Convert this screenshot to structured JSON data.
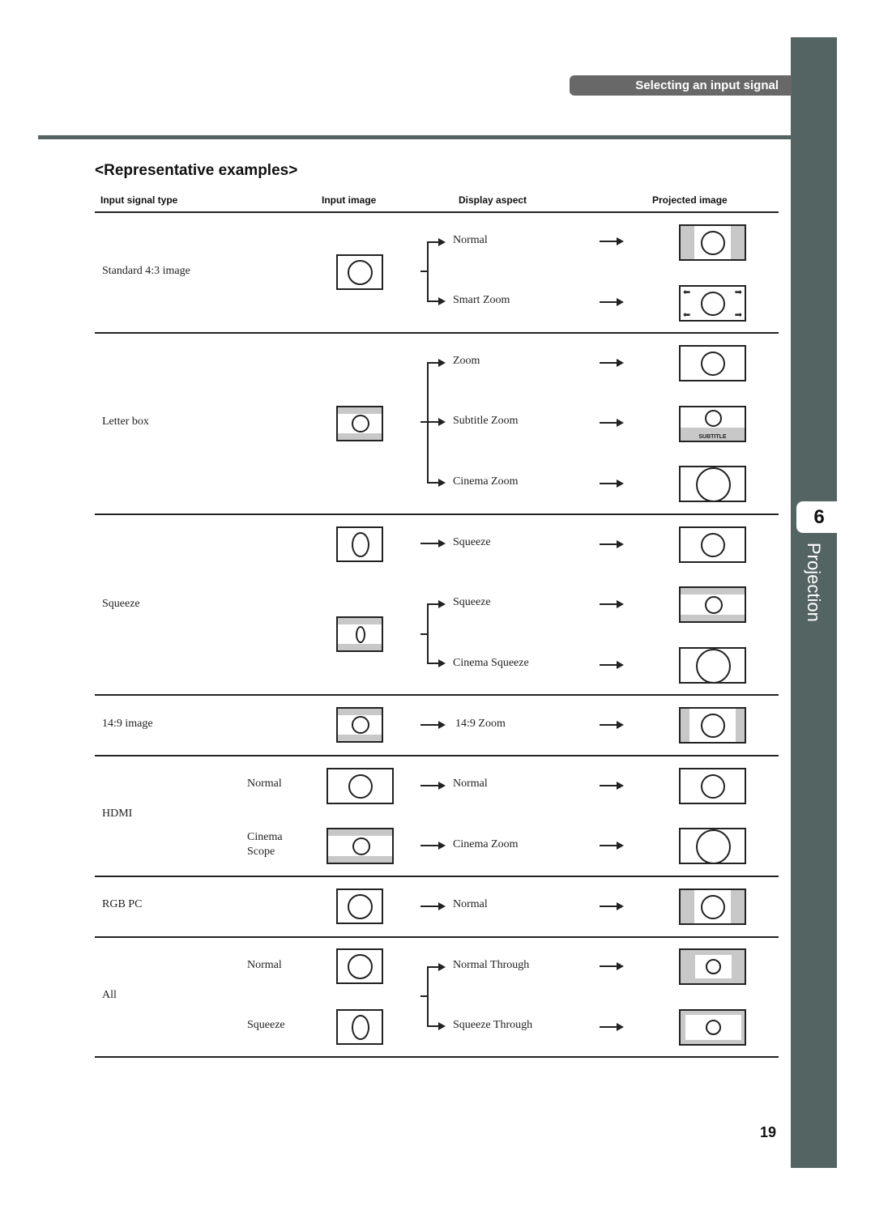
{
  "header": {
    "section_label": "Selecting an input signal",
    "chapter_number": "6",
    "chapter_label": "Projection"
  },
  "title": "<Representative examples>",
  "columns": [
    "Input signal type",
    "Input image",
    "Display aspect",
    "Projected image"
  ],
  "groups": [
    {
      "signal_type": "Standard 4:3 image",
      "rows": [
        {
          "sub_type": "",
          "display_aspect": "Normal",
          "input_image": "4:3 circle",
          "projected_image": "pillarbox circle"
        },
        {
          "sub_type": "",
          "display_aspect": "Smart Zoom",
          "input_image": "4:3 circle",
          "projected_image": "stretched edges circle"
        }
      ]
    },
    {
      "signal_type": "Letter box",
      "rows": [
        {
          "sub_type": "",
          "display_aspect": "Zoom",
          "input_image": "letterbox circle",
          "projected_image": "full circle"
        },
        {
          "sub_type": "",
          "display_aspect": "Subtitle Zoom",
          "input_image": "letterbox circle",
          "projected_image": "circle with subtitle band"
        },
        {
          "sub_type": "",
          "display_aspect": "Cinema Zoom",
          "input_image": "letterbox circle",
          "projected_image": "large circle"
        }
      ],
      "subtitle_label": "SUBTITLE"
    },
    {
      "signal_type": "Squeeze",
      "rows": [
        {
          "sub_type": "",
          "display_aspect": "Squeeze",
          "input_image": "squeezed oval",
          "projected_image": "full circle"
        },
        {
          "sub_type": "",
          "display_aspect": "Squeeze",
          "input_image": "letterbox squeezed oval",
          "projected_image": "letterbox circle"
        },
        {
          "sub_type": "",
          "display_aspect": "Cinema Squeeze",
          "input_image": "letterbox squeezed oval",
          "projected_image": "large circle"
        }
      ]
    },
    {
      "signal_type": "14:9 image",
      "rows": [
        {
          "sub_type": "",
          "display_aspect": "14:9 Zoom",
          "input_image": "14:9 letterbox",
          "projected_image": "pillarbox circle"
        }
      ]
    },
    {
      "signal_type": "HDMI",
      "rows": [
        {
          "sub_type": "Normal",
          "display_aspect": "Normal",
          "input_image": "wide circle",
          "projected_image": "full circle"
        },
        {
          "sub_type_lines": [
            "Cinema",
            "Scope"
          ],
          "display_aspect": "Cinema Zoom",
          "input_image": "scope letterbox",
          "projected_image": "large circle"
        }
      ]
    },
    {
      "signal_type": "RGB PC",
      "rows": [
        {
          "sub_type": "",
          "display_aspect": "Normal",
          "input_image": "4:3 circle",
          "projected_image": "pillarbox circle"
        }
      ]
    },
    {
      "signal_type": "All",
      "rows": [
        {
          "sub_type": "Normal",
          "display_aspect": "Normal Through",
          "input_image": "4:3 circle",
          "projected_image": "windowboxed circle"
        },
        {
          "sub_type": "Squeeze",
          "display_aspect": "Squeeze Through",
          "input_image": "squeezed oval",
          "projected_image": "windowboxed circle wide"
        }
      ]
    }
  ],
  "page_number": "19"
}
